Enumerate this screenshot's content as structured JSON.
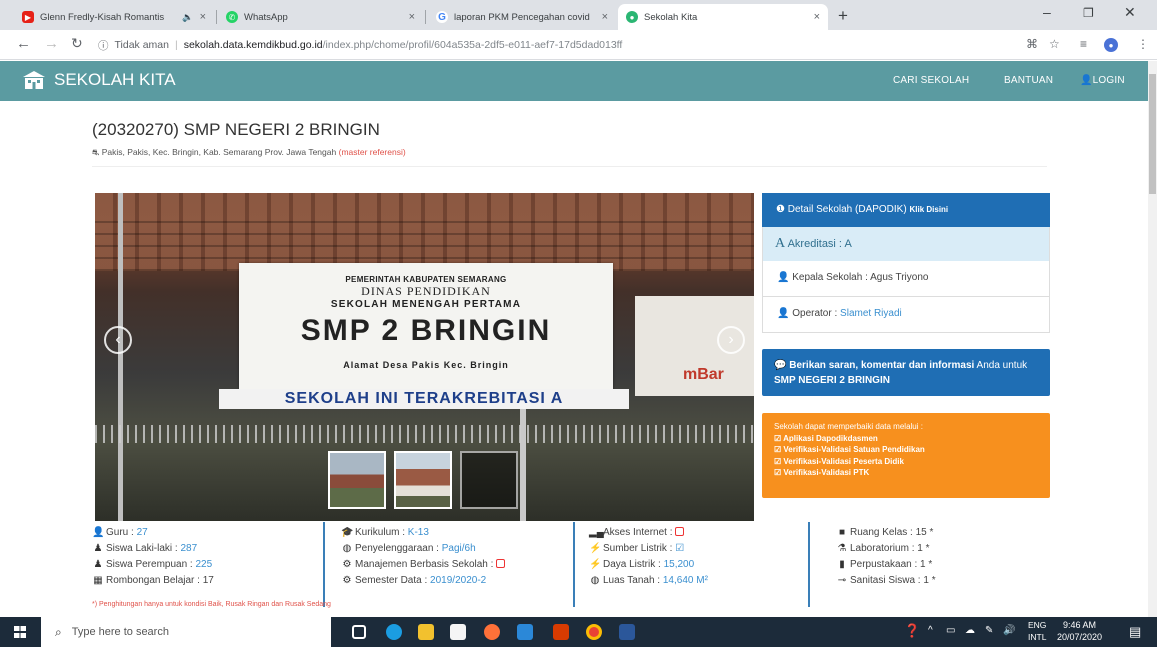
{
  "browser": {
    "tabs": [
      {
        "title": "Glenn Fredly-Kisah Romantis",
        "active": false,
        "favicon_color": "#e62117"
      },
      {
        "title": "WhatsApp",
        "active": false,
        "favicon_color": "#25d366"
      },
      {
        "title": "laporan PKM Pencegahan covid",
        "active": false,
        "favicon_color": "#4285f4"
      },
      {
        "title": "Sekolah Kita",
        "active": true,
        "favicon_color": "#2bb673"
      }
    ],
    "address": {
      "security_label": "Tidak aman",
      "url_host": "sekolah.data.kemdikbud.go.id",
      "url_path": "/index.php/chome/profil/604a535a-2df5-e011-aef7-17d5dad013ff"
    }
  },
  "site": {
    "brand": "SEKOLAH KITA",
    "nav": {
      "cari": "CARI SEKOLAH",
      "bantuan": "BANTUAN",
      "login": "LOGIN"
    },
    "accent": "#5b9ba1"
  },
  "school": {
    "title": "(20320270) SMP NEGERI 2 BRINGIN",
    "address": "Pakis, Pakis, Kec. Bringin, Kab. Semarang Prov. Jawa Tengah",
    "ref_link": "(master referensi)"
  },
  "photo_sign": {
    "line1": "PEMERINTAH KABUPATEN SEMARANG",
    "line2": "DINAS PENDIDIKAN",
    "line3": "SEKOLAH MENENGAH PERTAMA",
    "line4": "SMP 2 BRINGIN",
    "line5": "Alamat Desa Pakis Kec. Bringin",
    "banner": "SEKOLAH INI TERAKREBITASI A",
    "side": "mBar"
  },
  "panel": {
    "detail": "Detail Sekolah (DAPODIK)",
    "detail_link": "Klik Disini",
    "akreditasi_label": "Akreditasi :",
    "akreditasi_value": "A",
    "kepala_label": "Kepala Sekolah :",
    "kepala_value": "Agus Triyono",
    "operator_label": "Operator :",
    "operator_value": "Slamet Riyadi",
    "saran_prefix": "Berikan saran, komentar dan informasi",
    "saran_mid": "Anda untuk",
    "saran_school": "SMP NEGERI 2 BRINGIN",
    "orange_intro": "Sekolah dapat memperbaiki data melalui :",
    "orange_items": [
      "Aplikasi Dapodikdasmen",
      "Verifikasi-Validasi Satuan Pendidikan",
      "Verifikasi-Validasi Peserta Didik",
      "Verifikasi-Validasi PTK"
    ]
  },
  "stats": {
    "col1": [
      {
        "label": "Guru :",
        "value": "27"
      },
      {
        "label": "Siswa Laki-laki :",
        "value": "287"
      },
      {
        "label": "Siswa Perempuan :",
        "value": "225"
      },
      {
        "label": "Rombongan Belajar :",
        "value": "17"
      }
    ],
    "col2": [
      {
        "label": "Kurikulum :",
        "value": "K-13"
      },
      {
        "label": "Penyelenggaraan :",
        "value": "Pagi/6h"
      },
      {
        "label": "Manajemen Berbasis Sekolah :",
        "value": ""
      },
      {
        "label": "Semester Data :",
        "value": "2019/2020-2"
      }
    ],
    "col3": [
      {
        "label": "Akses Internet :",
        "value": ""
      },
      {
        "label": "Sumber Listrik :",
        "value": ""
      },
      {
        "label": "Daya Listrik :",
        "value": "15,200"
      },
      {
        "label": "Luas Tanah :",
        "value": "14,640 M²"
      }
    ],
    "col4": [
      {
        "label": "Ruang Kelas :",
        "value": "15 *"
      },
      {
        "label": "Laboratorium :",
        "value": "1 *"
      },
      {
        "label": "Perpustakaan :",
        "value": "1 *"
      },
      {
        "label": "Sanitasi Siswa :",
        "value": "1 *"
      }
    ],
    "note": "*) Penghitungan hanya untuk kondisi Baik, Rusak Ringan dan Rusak Sedang"
  },
  "taskbar": {
    "search_placeholder": "Type here to search",
    "lang1": "ENG",
    "lang2": "INTL",
    "time": "9:46 AM",
    "date": "20/07/2020"
  }
}
